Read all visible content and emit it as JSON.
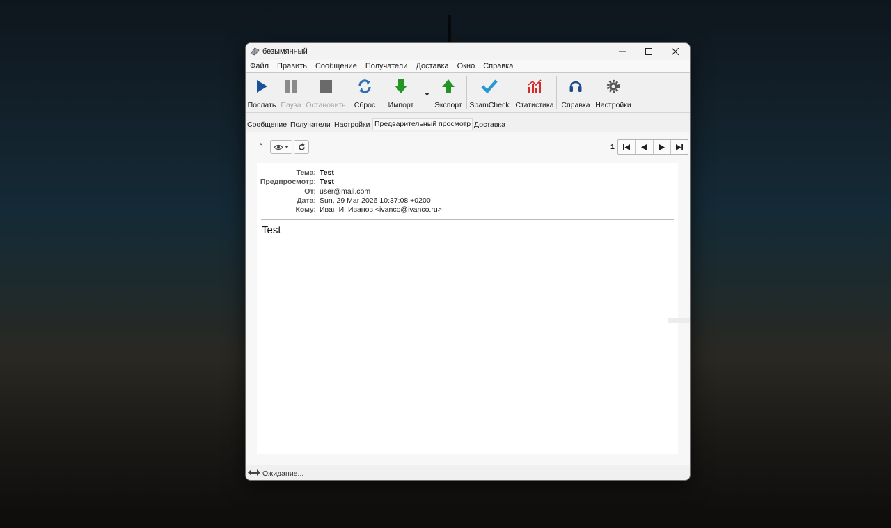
{
  "window": {
    "title": "безымянный"
  },
  "menu": [
    "Файл",
    "Править",
    "Сообщение",
    "Получатели",
    "Доставка",
    "Окно",
    "Справка"
  ],
  "toolbar": {
    "send": "Послать",
    "pause": "Пауза",
    "stop": "Остановить",
    "reset": "Сброс",
    "import": "Импорт",
    "export": "Экспорт",
    "spamcheck": "SpamCheck",
    "stats": "Статистика",
    "help": "Справка",
    "settings": "Настройки"
  },
  "tabs": [
    "Сообщение",
    "Получатели",
    "Настройки",
    "Предварительный просмотр",
    "Доставка"
  ],
  "active_tab": "Предварительный просмотр",
  "pager": {
    "page": "1"
  },
  "preview": {
    "headers": [
      {
        "label": "Тема:",
        "value": "Test"
      },
      {
        "label": "Предпросмотр:",
        "value": "Test"
      },
      {
        "label": "От:",
        "value": "user@mail.com"
      },
      {
        "label": "Дата:",
        "value": "Sun, 29 Mar 2026 10:37:08 +0200"
      },
      {
        "label": "Кому:",
        "value": "Иван И. Иванов <ivanco@ivanco.ru>"
      }
    ],
    "body": "Test"
  },
  "status": {
    "text": "Ожидание..."
  },
  "colors": {
    "send": "#1a4f9c",
    "disabled": "#8a8a8a",
    "reset": "#2b6fb5",
    "import": "#229622",
    "export": "#229622",
    "spamcheck": "#2a96d2",
    "stats": "#d42a2a",
    "help": "#1e4a8a",
    "settings": "#555555"
  }
}
